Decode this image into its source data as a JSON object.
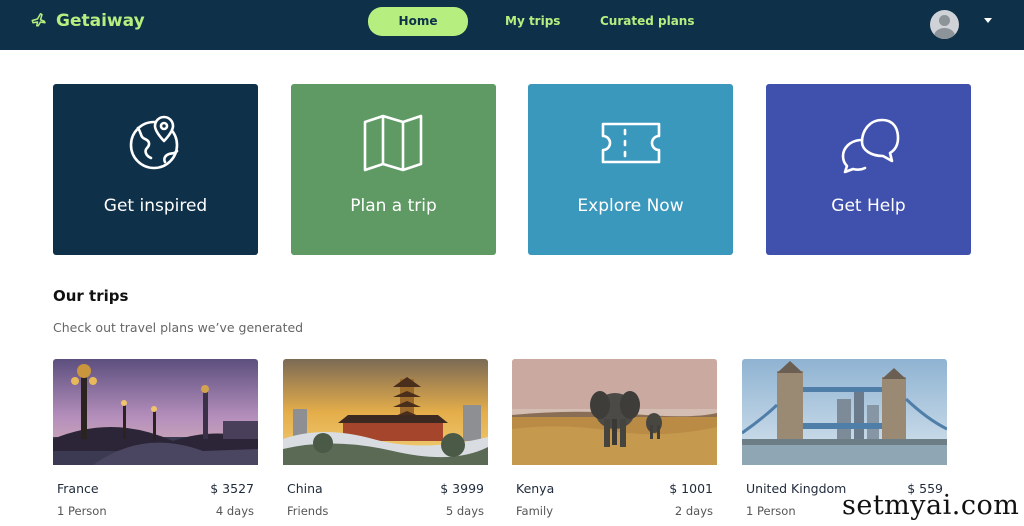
{
  "brand": {
    "name": "Getaiway",
    "icon": "airplane-icon"
  },
  "nav": {
    "home": "Home",
    "my_trips": "My trips",
    "curated": "Curated plans"
  },
  "colors": {
    "nav_bg": "#0f3049",
    "accent": "#b6ef80",
    "card_inspired": "#0f3049",
    "card_plan": "#5f9963",
    "card_explore": "#3b98bd",
    "card_help": "#4051ad"
  },
  "cards": [
    {
      "label": "Get inspired",
      "icon": "globe-pin-icon"
    },
    {
      "label": "Plan a trip",
      "icon": "map-icon"
    },
    {
      "label": "Explore Now",
      "icon": "ticket-icon"
    },
    {
      "label": "Get Help",
      "icon": "chat-bubbles-icon"
    }
  ],
  "section": {
    "title": "Our trips",
    "subtitle": "Check out travel plans we’ve generated"
  },
  "trips": [
    {
      "country": "France",
      "price": "$ 3527",
      "people": "1 Person",
      "days": "4 days",
      "image": "paris-bridge-photo"
    },
    {
      "country": "China",
      "price": "$ 3999",
      "people": "Friends",
      "days": "5 days",
      "image": "chinese-pagoda-photo"
    },
    {
      "country": "Kenya",
      "price": "$ 1001",
      "people": "Family",
      "days": "2 days",
      "image": "elephant-savanna-photo"
    },
    {
      "country": "United Kingdom",
      "price": "$ 559",
      "people": "1 Person",
      "days": "",
      "image": "tower-bridge-photo"
    }
  ],
  "watermark": "setmyai.com"
}
